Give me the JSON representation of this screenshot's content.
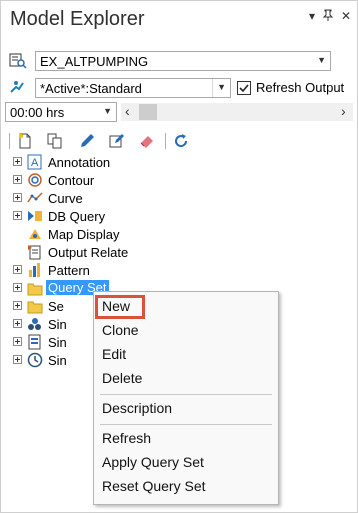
{
  "panel": {
    "title": "Model Explorer",
    "title_buttons": [
      {
        "name": "dropdown-icon",
        "glyph": "▾"
      },
      {
        "name": "pin-icon",
        "glyph": "⊥"
      },
      {
        "name": "close-icon",
        "glyph": "✕"
      }
    ]
  },
  "scenario": {
    "value": "EX_ALTPUMPING",
    "icon": "scenario-icon"
  },
  "alternative": {
    "value": "*Active*:Standard",
    "icon": "alternative-icon"
  },
  "refresh_output": {
    "label": "Refresh Output",
    "checked": true
  },
  "time": {
    "value": "00:00 hrs"
  },
  "tree": [
    {
      "label": "Annotation",
      "icon": "annotation-icon",
      "expandable": true
    },
    {
      "label": "Contour",
      "icon": "contour-icon",
      "expandable": true
    },
    {
      "label": "Curve",
      "icon": "curve-icon",
      "expandable": true
    },
    {
      "label": "DB Query",
      "icon": "db-query-icon",
      "expandable": true
    },
    {
      "label": "Map Display",
      "icon": "map-display-icon",
      "expandable": false
    },
    {
      "label": "Output Relate",
      "icon": "output-relate-icon",
      "expandable": false
    },
    {
      "label": "Pattern",
      "icon": "pattern-icon",
      "expandable": true
    },
    {
      "label": "Query Set",
      "icon": "query-set-icon",
      "expandable": true,
      "selected": true
    },
    {
      "label": "Se",
      "icon": "selection-set-icon",
      "expandable": true
    },
    {
      "label": "Sin",
      "icon": "simulation-icon",
      "expandable": true
    },
    {
      "label": "Sin",
      "icon": "simulation-options-icon",
      "expandable": true
    },
    {
      "label": "Sin",
      "icon": "simulation-time-icon",
      "expandable": true
    }
  ],
  "context_menu": {
    "items": [
      {
        "label": "New",
        "highlighted": true
      },
      {
        "label": "Clone"
      },
      {
        "label": "Edit"
      },
      {
        "label": "Delete"
      },
      {
        "label": "Description"
      },
      {
        "label": "Refresh"
      },
      {
        "label": "Apply Query Set"
      },
      {
        "label": "Reset Query Set"
      }
    ]
  },
  "colors": {
    "selection": "#3399ff",
    "highlight_border": "#d9533b"
  }
}
